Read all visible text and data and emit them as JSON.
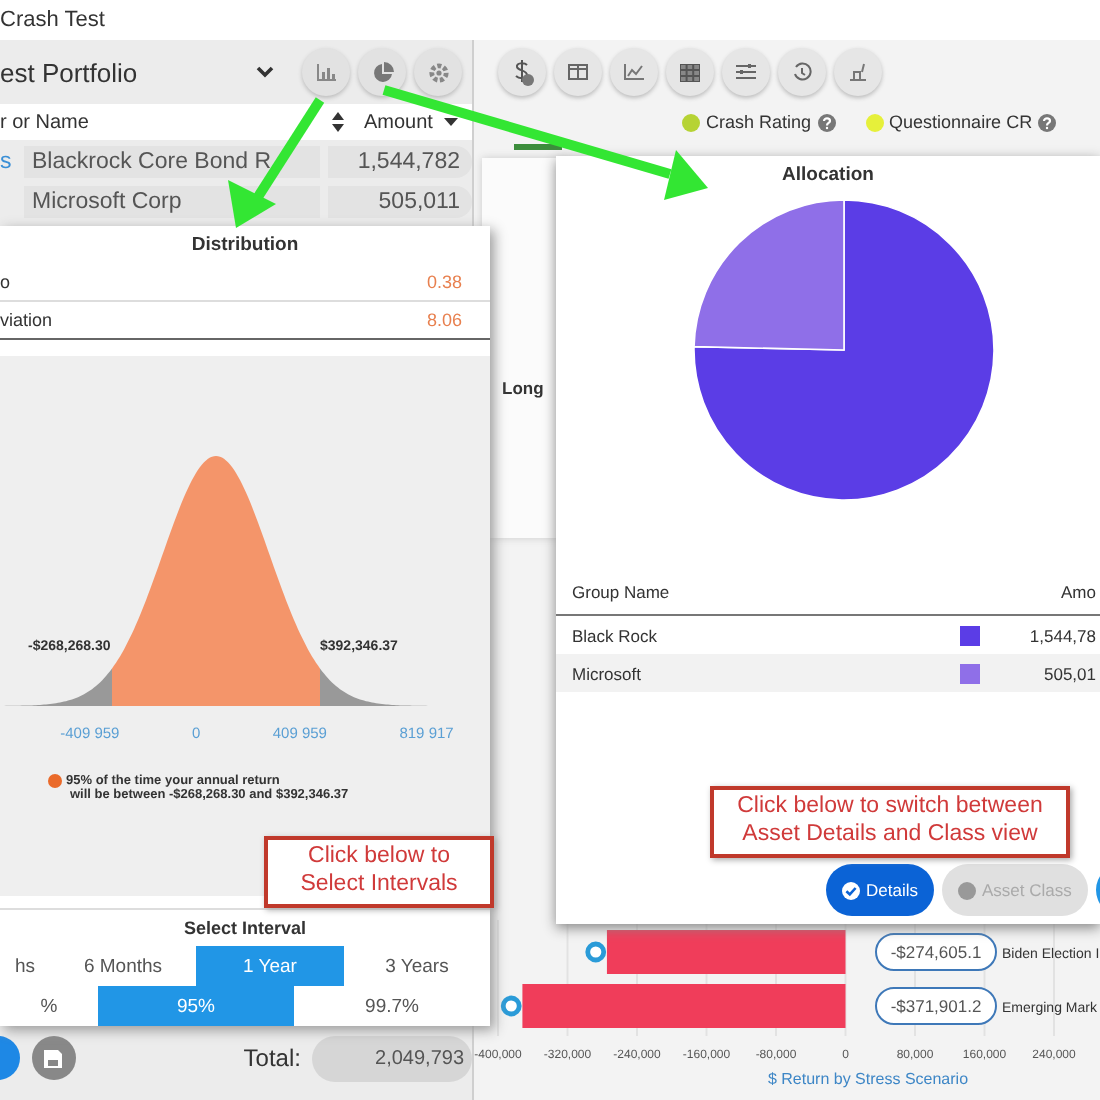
{
  "window": {
    "title": "Crash Test"
  },
  "portfolio": {
    "name": "est Portfolio"
  },
  "holdings": {
    "columns": [
      "r or Name",
      "Amount"
    ],
    "rows": [
      {
        "ticker": "s",
        "name": "Blackrock Core Bond R",
        "amount": "1,544,782"
      },
      {
        "name": "Microsoft Corp",
        "amount": "505,011"
      }
    ]
  },
  "total": {
    "label": "Total:",
    "value": "2,049,793"
  },
  "legend": [
    {
      "label": "Crash Rating",
      "color": "#b6d334"
    },
    {
      "label": "Questionnaire CR",
      "color": "#e6f03a"
    }
  ],
  "long_label": "Long",
  "stress_chart": {
    "chart_data": {
      "type": "bar",
      "orientation": "horizontal",
      "categories": [
        "Biden Election I",
        "Emerging Mark"
      ],
      "values": [
        -274605.1,
        -371901.2
      ],
      "value_labels": [
        "-$274,605.1",
        "-$371,901.2"
      ],
      "xlabel": "$ Return by Stress Scenario",
      "grid": true,
      "xlim": [
        -400000,
        240000
      ],
      "xticks": [
        {
          "value": -400000,
          "label": "-400,000"
        },
        {
          "value": -320000,
          "label": "-320,000"
        },
        {
          "value": -240000,
          "label": "-240,000"
        },
        {
          "value": -160000,
          "label": "-160,000"
        },
        {
          "value": -80000,
          "label": "-80,000"
        },
        {
          "value": 0,
          "label": "0"
        },
        {
          "value": 80000,
          "label": "80,000"
        },
        {
          "value": 160000,
          "label": "160,000"
        },
        {
          "value": 240000,
          "label": "240,000"
        }
      ]
    }
  },
  "distribution": {
    "title": "Distribution",
    "stats": [
      {
        "label": "o",
        "value": "0.38"
      },
      {
        "label": "viation",
        "value": "8.06"
      }
    ],
    "lower_label": "-$268,268.30",
    "upper_label": "$392,346.37",
    "axis_ticks": [
      "-409 959",
      "0",
      "409 959",
      "819 917"
    ],
    "note_lines": [
      "95% of the time your annual return",
      "will be between -$268,268.30 and $392,346.37"
    ],
    "interval_title": "Select Interval",
    "periods": [
      {
        "label": "hs",
        "selected": false
      },
      {
        "label": "6 Months",
        "selected": false
      },
      {
        "label": "1 Year",
        "selected": true
      },
      {
        "label": "3 Years",
        "selected": false
      }
    ],
    "confidence": [
      {
        "label": "%",
        "selected": false
      },
      {
        "label": "95%",
        "selected": true
      },
      {
        "label": "99.7%",
        "selected": false
      }
    ]
  },
  "allocation": {
    "title": "Allocation",
    "chart_data": {
      "type": "pie",
      "categories": [
        "Black Rock",
        "Microsoft"
      ],
      "values": [
        75.36,
        24.64
      ]
    },
    "columns": [
      "Group Name",
      "Amo"
    ],
    "rows": [
      {
        "color": "#5b3de6",
        "amount": "1,544,78"
      },
      {
        "color": "#8f6fe8",
        "amount": "505,01"
      }
    ],
    "view_buttons": [
      {
        "label": "Details",
        "selected": true
      },
      {
        "label": "Asset Class",
        "selected": false
      }
    ]
  },
  "callouts": [
    {
      "text": "Click below to Select Intervals"
    },
    {
      "text": "Click below to switch between Asset Details and Class view"
    }
  ]
}
